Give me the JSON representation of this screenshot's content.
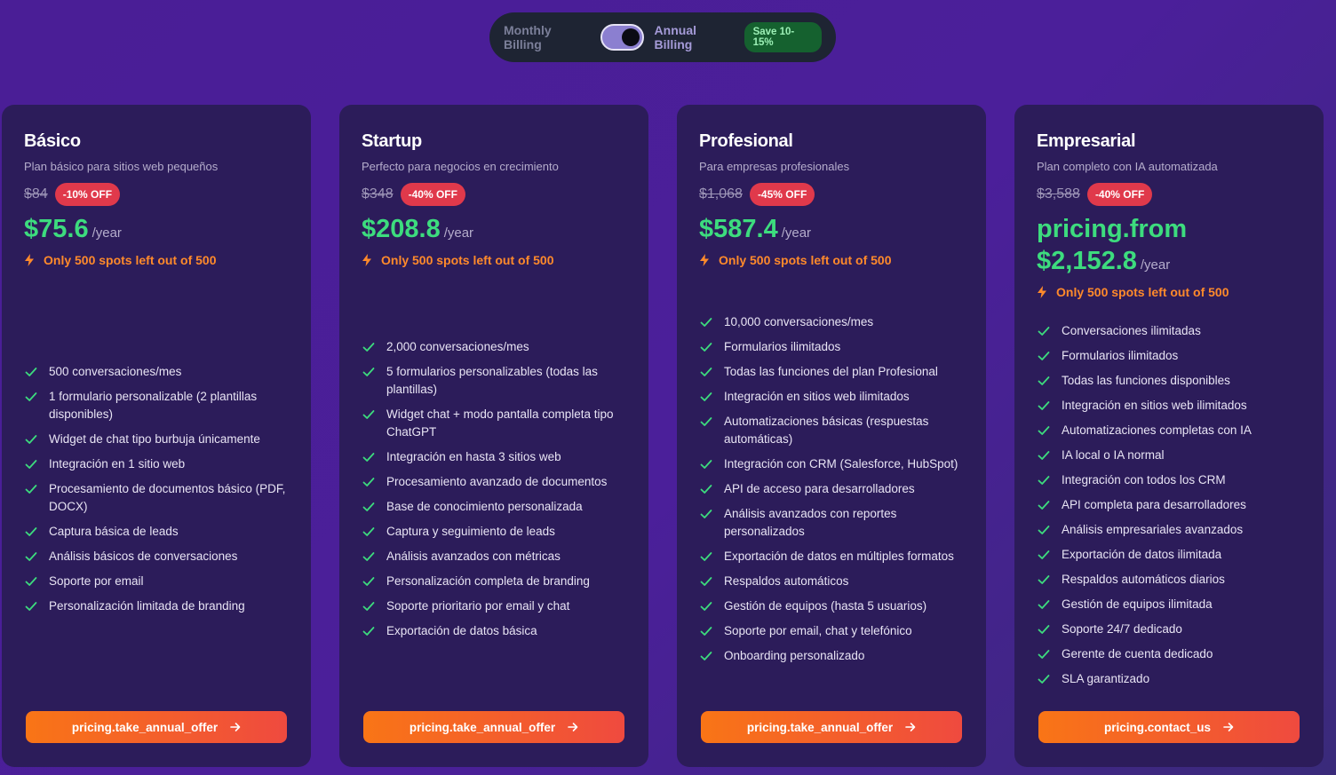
{
  "billing": {
    "monthly_label": "Monthly Billing",
    "annual_label": "Annual Billing",
    "save_badge": "Save 10-15%"
  },
  "plans": [
    {
      "name": "Básico",
      "description": "Plan básico para sitios web pequeños",
      "old_price": "$84",
      "discount": "-10% OFF",
      "price": "$75.6",
      "period": "/year",
      "spots": "Only 500 spots left out of 500",
      "cta": "pricing.take_annual_offer",
      "features": [
        "500 conversaciones/mes",
        "1 formulario personalizable (2 plantillas disponibles)",
        "Widget de chat tipo burbuja únicamente",
        "Integración en 1 sitio web",
        "Procesamiento de documentos básico (PDF, DOCX)",
        "Captura básica de leads",
        "Análisis básicos de conversaciones",
        "Soporte por email",
        "Personalización limitada de branding"
      ]
    },
    {
      "name": "Startup",
      "description": "Perfecto para negocios en crecimiento",
      "old_price": "$348",
      "discount": "-40% OFF",
      "price": "$208.8",
      "period": "/year",
      "spots": "Only 500 spots left out of 500",
      "cta": "pricing.take_annual_offer",
      "features": [
        "2,000 conversaciones/mes",
        "5 formularios personalizables (todas las plantillas)",
        "Widget chat + modo pantalla completa tipo ChatGPT",
        "Integración en hasta 3 sitios web",
        "Procesamiento avanzado de documentos",
        "Base de conocimiento personalizada",
        "Captura y seguimiento de leads",
        "Análisis avanzados con métricas",
        "Personalización completa de branding",
        "Soporte prioritario por email y chat",
        "Exportación de datos básica"
      ]
    },
    {
      "name": "Profesional",
      "description": "Para empresas profesionales",
      "old_price": "$1,068",
      "discount": "-45% OFF",
      "price": "$587.4",
      "period": "/year",
      "spots": "Only 500 spots left out of 500",
      "cta": "pricing.take_annual_offer",
      "features": [
        "10,000 conversaciones/mes",
        "Formularios ilimitados",
        "Todas las funciones del plan Profesional",
        "Integración en sitios web ilimitados",
        "Automatizaciones básicas (respuestas automáticas)",
        "Integración con CRM (Salesforce, HubSpot)",
        "API de acceso para desarrolladores",
        "Análisis avanzados con reportes personalizados",
        "Exportación de datos en múltiples formatos",
        "Respaldos automáticos",
        "Gestión de equipos (hasta 5 usuarios)",
        "Soporte por email, chat y telefónico",
        "Onboarding personalizado"
      ]
    },
    {
      "name": "Empresarial",
      "description": "Plan completo con IA automatizada",
      "old_price": "$3,588",
      "discount": "-40% OFF",
      "price_prefix": "pricing.from",
      "price": "$2,152.8",
      "period": "/year",
      "spots": "Only 500 spots left out of 500",
      "cta": "pricing.contact_us",
      "features": [
        "Conversaciones ilimitadas",
        "Formularios ilimitados",
        "Todas las funciones disponibles",
        "Integración en sitios web ilimitados",
        "Automatizaciones completas con IA",
        "IA local o IA normal",
        "Integración con todos los CRM",
        "API completa para desarrolladores",
        "Análisis empresariales avanzados",
        "Exportación de datos ilimitada",
        "Respaldos automáticos diarios",
        "Gestión de equipos ilimitada",
        "Soporte 24/7 dedicado",
        "Gerente de cuenta dedicado",
        "SLA garantizado"
      ]
    }
  ],
  "colors": {
    "price_green": "#3ddc7e",
    "discount_red": "#e0394b",
    "spots_orange": "#ff8a2b",
    "check_green": "#3ddc7e",
    "cta_gradient_start": "#f97516",
    "cta_gradient_end": "#ef4a3f"
  },
  "icons": {
    "spots": "bolt-icon",
    "feature": "check-icon",
    "cta": "arrow-right-icon"
  }
}
